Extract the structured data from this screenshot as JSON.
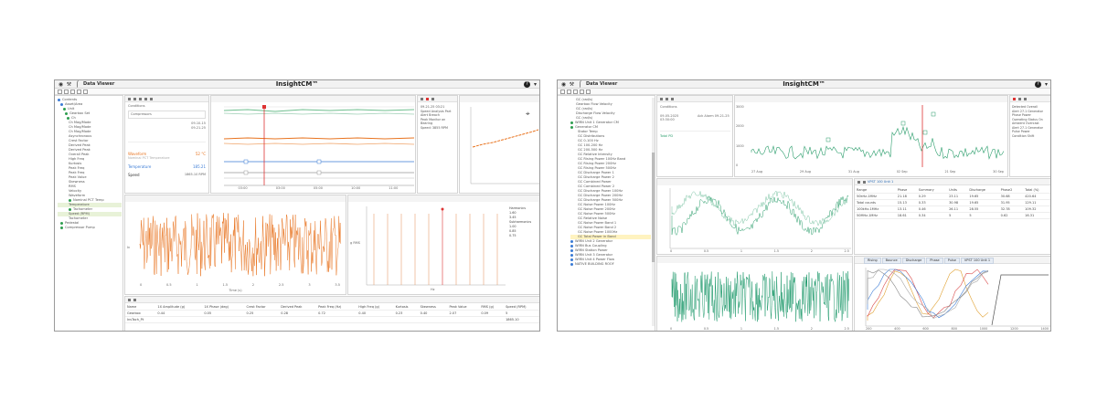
{
  "left": {
    "app_name": "Data Viewer",
    "title": "InsightCM™",
    "tree": [
      {
        "label": "Contents",
        "color": "#3a7bd5"
      },
      {
        "label": "Asset/Area",
        "color": "#3a7bd5"
      },
      {
        "label": "Unit",
        "color": "#2e9e4f"
      },
      {
        "label": "Gearbox Set",
        "color": "#2e9e4f"
      },
      {
        "label": "Ch",
        "color": "#2e9e4f"
      },
      {
        "label": "Ch Mag/Mode",
        "color": ""
      },
      {
        "label": "Ch Mag/Mode",
        "color": ""
      },
      {
        "label": "Ch Mag/Mode",
        "color": ""
      },
      {
        "label": "Asynchronous",
        "color": ""
      },
      {
        "label": "Crest Factor",
        "color": ""
      },
      {
        "label": "Derived Peak",
        "color": ""
      },
      {
        "label": "Derived Peak",
        "color": ""
      },
      {
        "label": "Overall Peak",
        "color": ""
      },
      {
        "label": "High Freq",
        "color": ""
      },
      {
        "label": "Kurtosis",
        "color": ""
      },
      {
        "label": "Peak Freq",
        "color": ""
      },
      {
        "label": "Peak Freq",
        "color": ""
      },
      {
        "label": "Peak Value",
        "color": ""
      },
      {
        "label": "Skewness",
        "color": ""
      },
      {
        "label": "RMS",
        "color": ""
      },
      {
        "label": "Velocity",
        "color": ""
      },
      {
        "label": "Waveform",
        "color": ""
      },
      {
        "label": "Nominal PCT Temp",
        "color": "#2e9e4f"
      },
      {
        "label": "Temperature",
        "color": "",
        "hl": true
      },
      {
        "label": "Tachometer",
        "color": "#2e9e4f"
      },
      {
        "label": "Speed (RPM)",
        "color": "",
        "hl": true
      },
      {
        "label": "Tachometer",
        "color": ""
      },
      {
        "label": "Pedestal",
        "color": "#2e9e4f"
      },
      {
        "label": "Compressor Pump",
        "color": "#2e9e4f"
      }
    ],
    "info": {
      "conditions": "Conditions",
      "row1": "Compressors",
      "date1": "09-10-15",
      "date2": "09-21-25",
      "trend_label": "Waveform",
      "trend_value": "52 °C",
      "sub_label": "Nominal PCT Temperature",
      "temp_label": "Temperature",
      "temp_value": "185.21",
      "speed_label": "Speed",
      "speed_value": "1865.10 RPM"
    },
    "event_text": [
      "09-21-25 03:21",
      "Speed Analysis Part",
      "Alert Breach",
      "Peak Monitor on Bearing",
      "Speed: 3855 RPM"
    ],
    "timeline_ticks": [
      "03:00",
      "03:00",
      "05:00",
      "10:00",
      "11:00"
    ],
    "waveform_ylabel": "In",
    "waveform_xlabel": "Time (s)",
    "waveform_xticks": [
      "0",
      "0.5",
      "1",
      "1.5",
      "2",
      "2.5",
      "3",
      "3.5"
    ],
    "spectrum_ylabel": "g RMS",
    "spectrum_xlabel": "Hz",
    "spectrum_legend": [
      "Harmonics",
      "1.60",
      "3.45",
      "Subharmonics",
      "1.00",
      "0.85",
      "0.75"
    ],
    "table_headers": [
      "Name",
      "1X Amplitude (g)",
      "1X Phase (deg)",
      "Crest Factor",
      "Derived Peak",
      "Peak Freq (Hz)",
      "High Freq (g)",
      "Kurtosis",
      "Skewness",
      "Peak Value",
      "RMS (g)",
      "Speed (RPM)"
    ],
    "table_rows": [
      [
        "Gearbox",
        "0.44",
        "0.05",
        "0.25",
        "0.28",
        "0.72",
        "0.40",
        "0.23",
        "0.40",
        "2.07",
        "0.09",
        "5"
      ],
      [
        "InsTach_Pt",
        "",
        "",
        "",
        "",
        "",
        "",
        "",
        "",
        "",
        "",
        "1865.10"
      ]
    ]
  },
  "right": {
    "app_name": "Data Viewer",
    "title": "InsightCM™",
    "tree": [
      {
        "label": "GC (rad/s)",
        "color": ""
      },
      {
        "label": "Gearbox Flow Velocity",
        "color": ""
      },
      {
        "label": "GC (rad/s)",
        "color": ""
      },
      {
        "label": "Discharge Flow Velocity",
        "color": ""
      },
      {
        "label": "GC (rad/s)",
        "color": ""
      },
      {
        "label": "WIRN Unit 1 Generator CM",
        "color": "#2e9e4f"
      },
      {
        "label": "Generator CM",
        "color": "#2e9e4f"
      },
      {
        "label": "Stator Temp",
        "color": ""
      },
      {
        "label": "GC Distributions",
        "color": ""
      },
      {
        "label": "GC 0-100 Hz",
        "color": ""
      },
      {
        "label": "GC 100-200 Hz",
        "color": ""
      },
      {
        "label": "GC 200-500 Hz",
        "color": ""
      },
      {
        "label": "GC Relative Intensity",
        "color": ""
      },
      {
        "label": "GC Rising Power 100Hz Band",
        "color": ""
      },
      {
        "label": "GC Rising Power 200Hz",
        "color": ""
      },
      {
        "label": "GC Rising Power 500Hz",
        "color": ""
      },
      {
        "label": "GC Discharge Power 1",
        "color": ""
      },
      {
        "label": "GC Discharge Power 2",
        "color": ""
      },
      {
        "label": "GC Combined Power",
        "color": ""
      },
      {
        "label": "GC Combined Power 2",
        "color": ""
      },
      {
        "label": "GC Discharge Power 100Hz",
        "color": ""
      },
      {
        "label": "GC Discharge Power 200Hz",
        "color": ""
      },
      {
        "label": "GC Discharge Power 500Hz",
        "color": ""
      },
      {
        "label": "GC Noise Power 100Hz",
        "color": ""
      },
      {
        "label": "GC Noise Power 200Hz",
        "color": ""
      },
      {
        "label": "GC Noise Power 500Hz",
        "color": ""
      },
      {
        "label": "GC Relative Noise",
        "color": ""
      },
      {
        "label": "GC Noise Power Band 1",
        "color": ""
      },
      {
        "label": "GC Noise Power Band 2",
        "color": ""
      },
      {
        "label": "GC Noise Power 1000Hz",
        "color": ""
      },
      {
        "label": "GC Total Power in Band",
        "color": "",
        "sel": true
      },
      {
        "label": "WIRN Unit 2 Generator",
        "color": "#3a7bd5"
      },
      {
        "label": "WIRN Bus Coupling",
        "color": "#3a7bd5"
      },
      {
        "label": "WIRN Station Power",
        "color": "#3a7bd5"
      },
      {
        "label": "WIRN Unit 3 Generator",
        "color": "#3a7bd5"
      },
      {
        "label": "WIRN Unit 4 Power Flow",
        "color": "#3a7bd5"
      },
      {
        "label": "NATIVE BUILDING ROOF",
        "color": "#3a7bd5"
      }
    ],
    "info": {
      "conditions": "Conditions",
      "col1": "09-05-2025 03:30:00",
      "col2": "Ack Alarm 09-21-25",
      "band_label": "Total PD"
    },
    "trend_xticks": [
      "27 Aug",
      "29 Aug",
      "31 Aug",
      "02 Sep",
      "21 Sep",
      "30 Sep"
    ],
    "trend_yticks": [
      "3000",
      "2000",
      "1000",
      "0"
    ],
    "event_text": [
      "Detected Overall",
      "Alert 27.1 Generator",
      "Phase Power",
      "Operating Status On",
      "Ambient Overcast",
      "Alert 27.1 Generator",
      "Pulse Power",
      "Condition Shift"
    ],
    "table_tab": "VPST 100 Unit 1",
    "table_headers": [
      "Range",
      "Phase",
      "Summary",
      "Units",
      "Discharge",
      "Phase2",
      "Total (%)"
    ],
    "table_rows": [
      [
        "50kHz-1MHz",
        "21.18",
        "0.29",
        "23.11",
        "19.65",
        "30.68",
        "420.64"
      ],
      [
        "Total counts",
        "15.13",
        "0.33",
        "30.98",
        "19.65",
        "31.95",
        "129.11"
      ],
      [
        "100kHz-1MHz",
        "13.11",
        "0.46",
        "26.11",
        "28.55",
        "32.78",
        "109.32"
      ],
      [
        "50MHz-1MHz",
        "18.61",
        "0.34",
        "5",
        "5",
        "0.62",
        "16.31"
      ]
    ],
    "mid_tabs": [
      "Rising",
      "Bounce",
      "Discharge",
      "Phase",
      "Pulse",
      "VPST 100 Unit 1"
    ],
    "waveform_xticks": [
      "0",
      "0.5",
      "1",
      "1.5",
      "2",
      "2.5"
    ],
    "multi_xticks": [
      "200",
      "400",
      "600",
      "800",
      "1000",
      "1200",
      "1400"
    ]
  },
  "colors": {
    "accent_orange": "#e8731f",
    "trend_green": "#2a9d6b",
    "alarm_red": "#d33",
    "tree_selected": "#fff3c0"
  }
}
